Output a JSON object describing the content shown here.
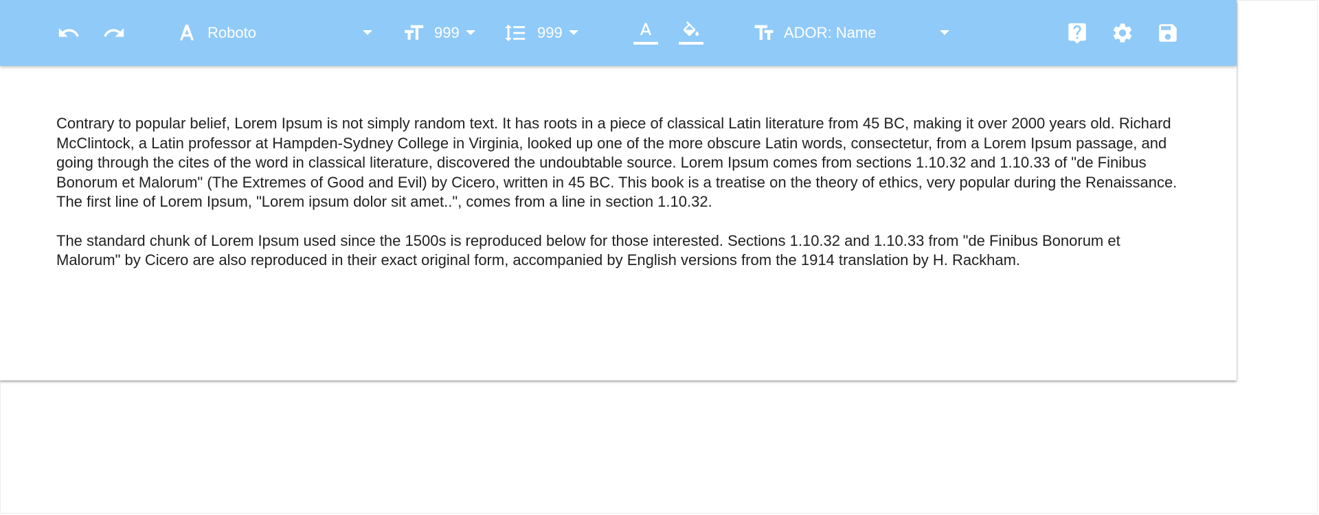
{
  "toolbar": {
    "undo_icon": "undo-icon",
    "redo_icon": "redo-icon",
    "font_icon": "font-icon",
    "font_family": "Roboto",
    "font_size_icon": "format-size-icon",
    "font_size": "999",
    "line_height_icon": "line-spacing-icon",
    "line_height": "999",
    "text_color_icon": "text-color-icon",
    "fill_color_icon": "fill-color-icon",
    "field_icon": "text-field-icon",
    "field_select": "ADOR: Name",
    "help_icon": "help-icon",
    "settings_icon": "settings-icon",
    "save_icon": "save-icon"
  },
  "colors": {
    "toolbar_bg": "#90caf9",
    "icon": "#ffffff",
    "text": "#212121"
  },
  "content": {
    "paragraphs": [
      "Contrary to popular belief, Lorem Ipsum is not simply random text. It has roots in a piece of classical Latin literature from 45 BC, making it over 2000 years old. Richard McClintock, a Latin professor at Hampden-Sydney College in Virginia, looked up one of the more obscure Latin words, consectetur, from a Lorem Ipsum passage, and going through the cites of the word in classical literature, discovered the undoubtable source. Lorem Ipsum comes from sections 1.10.32 and 1.10.33 of \"de Finibus Bonorum et Malorum\" (The Extremes of Good and Evil) by Cicero, written in 45 BC. This book is a treatise on the theory of ethics, very popular during the Renaissance. The first line of Lorem Ipsum, \"Lorem ipsum dolor sit amet..\", comes from a line in section 1.10.32.",
      "The standard chunk of Lorem Ipsum used since the 1500s is reproduced below for those interested. Sections 1.10.32 and 1.10.33 from \"de Finibus Bonorum et Malorum\" by Cicero are also reproduced in their exact original form, accompanied by English versions from the 1914 translation by H. Rackham."
    ]
  }
}
